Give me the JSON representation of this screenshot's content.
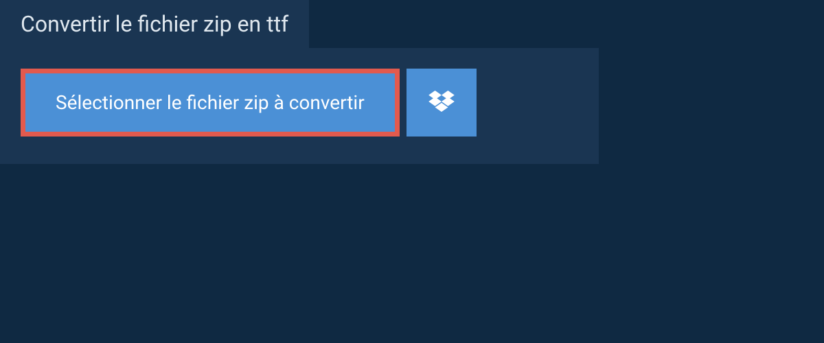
{
  "header": {
    "title": "Convertir le fichier zip en ttf"
  },
  "main": {
    "select_file_label": "Sélectionner le fichier zip à convertir"
  },
  "colors": {
    "background": "#0f2942",
    "panel": "#1a3552",
    "button": "#4b90d6",
    "highlight_border": "#e25a4e",
    "text_light": "#e0e8ef",
    "text_white": "#ffffff"
  }
}
